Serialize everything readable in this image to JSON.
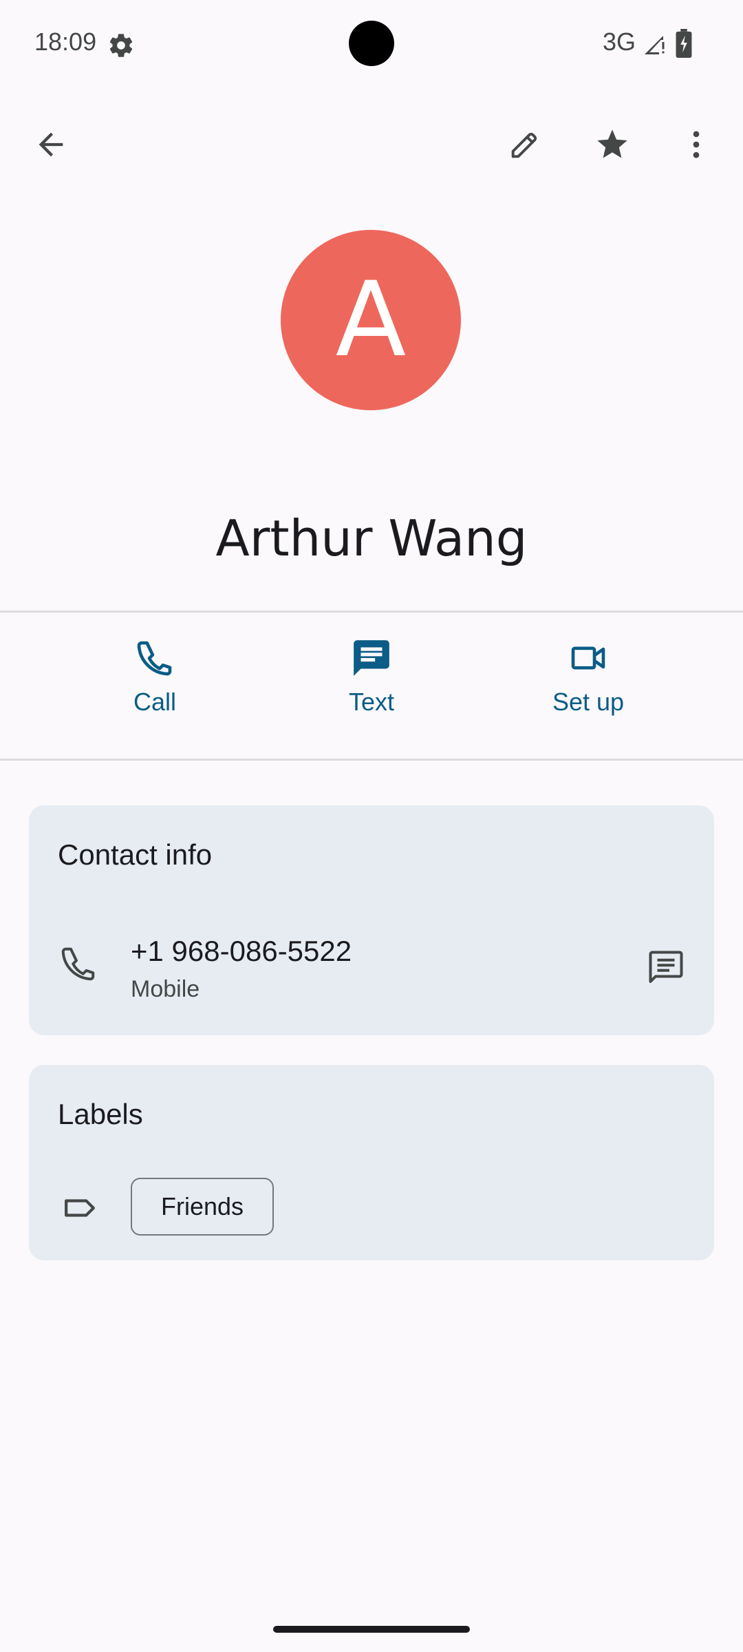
{
  "status_bar": {
    "time": "18:09",
    "network": "3G",
    "icons": [
      "settings-gear-icon",
      "signal-icon",
      "battery-charging-icon"
    ]
  },
  "top_bar": {
    "icons": [
      "back-arrow-icon",
      "edit-pencil-icon",
      "star-icon",
      "more-vert-icon"
    ]
  },
  "contact": {
    "avatar_letter": "A",
    "avatar_color": "#ee675c",
    "name": "Arthur Wang"
  },
  "actions": [
    {
      "label": "Call",
      "icon": "phone-icon"
    },
    {
      "label": "Text",
      "icon": "message-icon"
    },
    {
      "label": "Set up",
      "icon": "video-icon"
    }
  ],
  "contact_info": {
    "title": "Contact info",
    "phone": "+1 968-086-5522",
    "phone_type": "Mobile"
  },
  "labels": {
    "title": "Labels",
    "chips": [
      "Friends"
    ]
  },
  "colors": {
    "accent": "#0b5c86",
    "card_bg": "#e6ecf2",
    "page_bg": "#fbf9fc"
  }
}
